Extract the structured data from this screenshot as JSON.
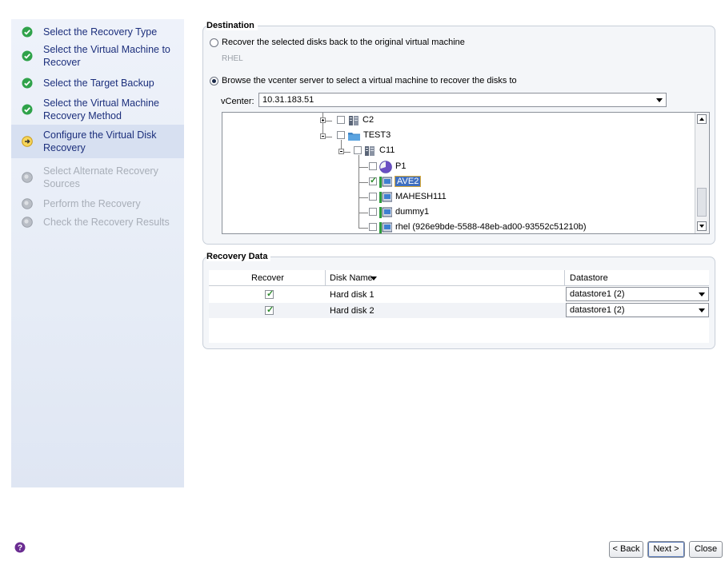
{
  "wizard": {
    "steps": [
      {
        "label": "Select the Recovery Type",
        "state": "done"
      },
      {
        "label": "Select the Virtual Machine to Recover",
        "state": "done"
      },
      {
        "label": "Select the Target Backup",
        "state": "done"
      },
      {
        "label": "Select the Virtual Machine Recovery Method",
        "state": "done"
      },
      {
        "label": "Configure the Virtual Disk Recovery",
        "state": "current"
      },
      {
        "label": "Select Alternate Recovery Sources",
        "state": "pending"
      },
      {
        "label": "Perform the Recovery",
        "state": "pending"
      },
      {
        "label": "Check the Recovery Results",
        "state": "pending"
      }
    ]
  },
  "destination": {
    "title": "Destination",
    "option1_label": "Recover the selected disks back to the original virtual machine",
    "option1_vm": "RHEL",
    "option2_label": "Browse the vcenter server to select a virtual machine to recover the disks to",
    "selected_option": 2,
    "vcenter_label": "vCenter:",
    "vcenter_value": "10.31.183.51",
    "tree": {
      "nodes": [
        {
          "label": "C2",
          "icon": "cluster-icon",
          "checked": false,
          "expander": "plus"
        },
        {
          "label": "TEST3",
          "icon": "folder-icon",
          "checked": false,
          "expander": "minus"
        },
        {
          "label": "C11",
          "icon": "cluster-icon",
          "checked": false,
          "expander": "minus"
        },
        {
          "label": "P1",
          "icon": "resource-pool-icon",
          "checked": false
        },
        {
          "label": "AVE2",
          "icon": "vm-icon",
          "checked": true,
          "selected": true
        },
        {
          "label": "MAHESH111",
          "icon": "vm-icon",
          "checked": false
        },
        {
          "label": "dummy1",
          "icon": "vm-icon",
          "checked": false
        },
        {
          "label": "rhel (926e9bde-5588-48eb-ad00-93552c51210b)",
          "icon": "vm-icon",
          "checked": false
        }
      ]
    }
  },
  "recovery_data": {
    "title": "Recovery Data",
    "columns": {
      "recover": "Recover",
      "disk_name": "Disk Name",
      "datastore": "Datastore"
    },
    "rows": [
      {
        "recover": true,
        "disk_name": "Hard disk 1",
        "datastore": "datastore1 (2)"
      },
      {
        "recover": true,
        "disk_name": "Hard disk 2",
        "datastore": "datastore1 (2)"
      }
    ]
  },
  "footer": {
    "back_label": "< Back",
    "next_label": "Next >",
    "close_label": "Close"
  },
  "colors": {
    "step_text": "#1c2f7c",
    "done_icon": "#2fa24a",
    "current_icon": "#f0c030",
    "pending_icon": "#a8aeb8"
  }
}
